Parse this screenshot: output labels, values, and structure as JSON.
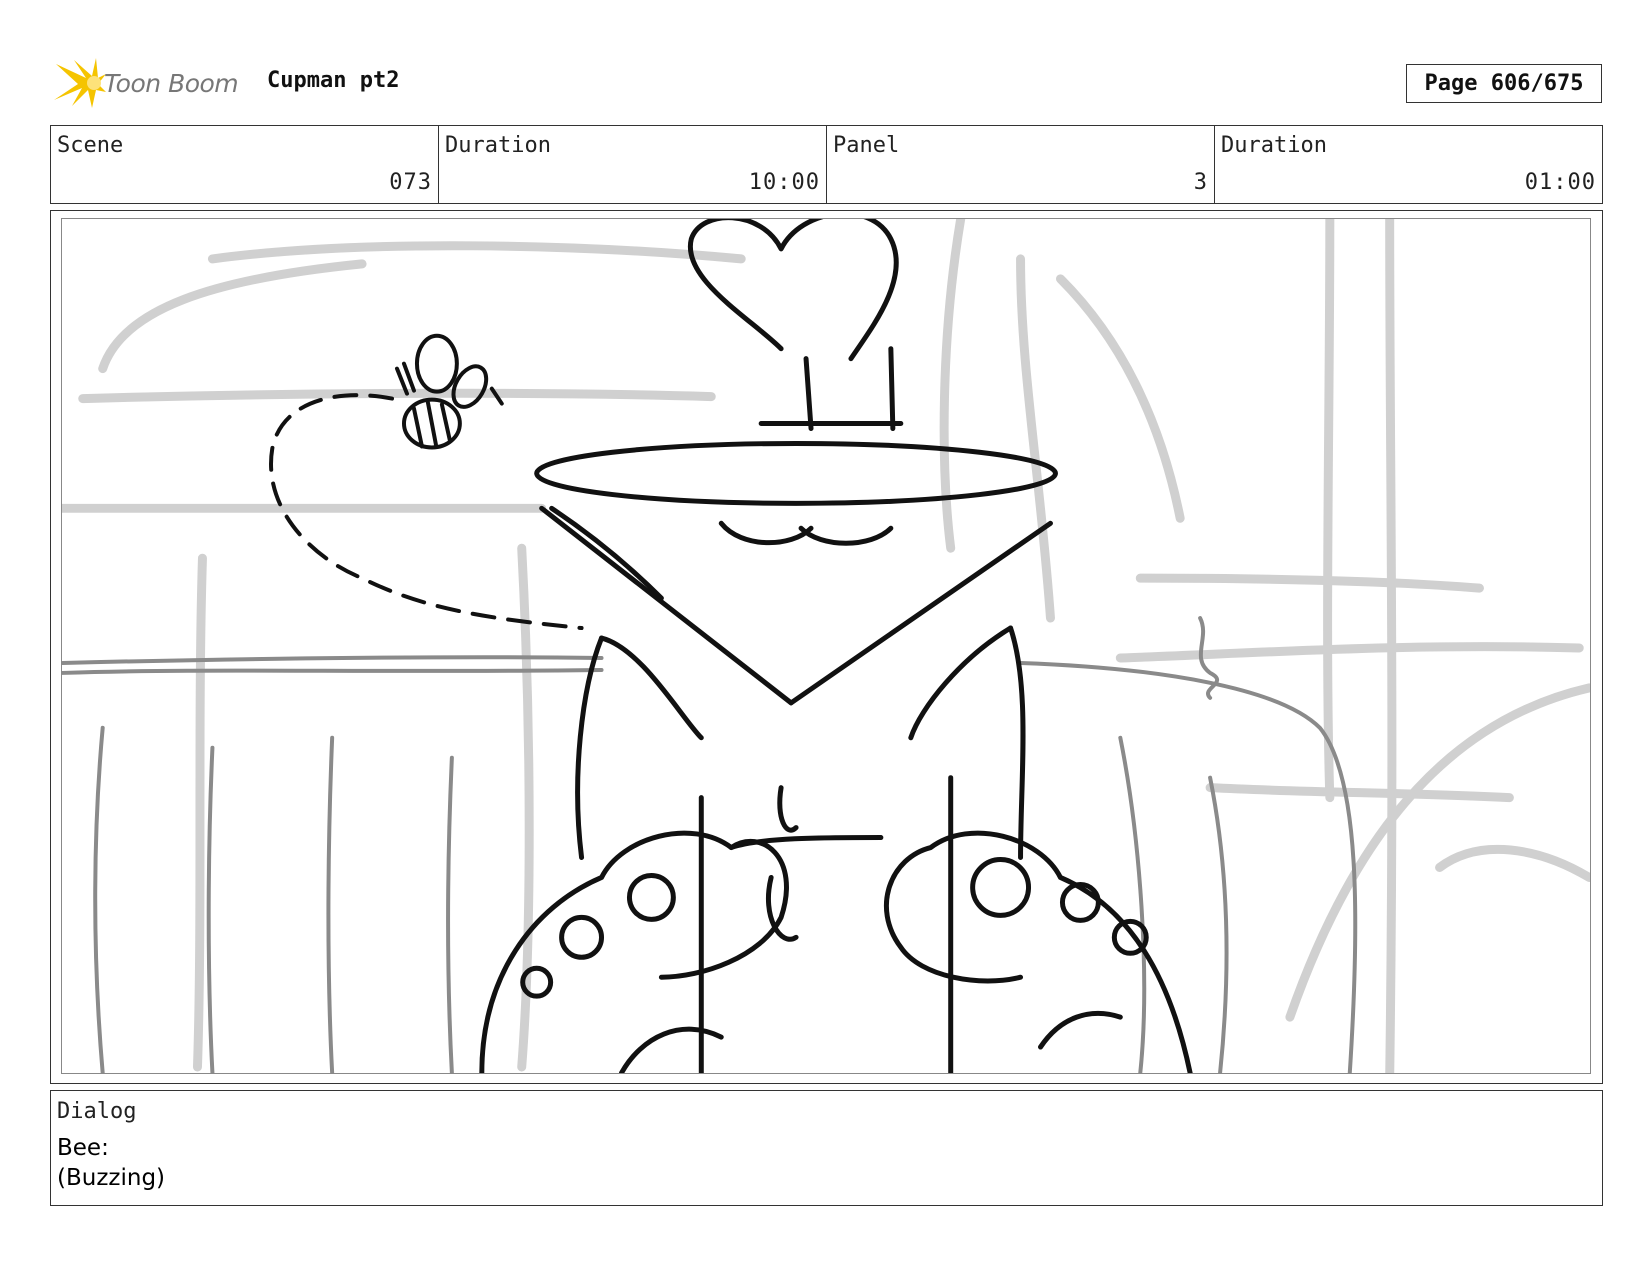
{
  "header": {
    "brand": "Toon Boom",
    "project_title": "Cupman pt2",
    "page_label": "Page 606/675"
  },
  "info": {
    "scene_label": "Scene",
    "scene_value": "073",
    "duration_label": "Duration",
    "duration_value": "10:00",
    "panel_label": "Panel",
    "panel_value": "3",
    "panel_duration_label": "Duration",
    "panel_duration_value": "01:00"
  },
  "dialog": {
    "label": "Dialog",
    "lines": [
      "Bee:",
      "(Buzzing)"
    ]
  },
  "colors": {
    "logo_accent": "#f5c400",
    "sketch_line": "#111111",
    "background_sketch": "#cfcfcf"
  }
}
